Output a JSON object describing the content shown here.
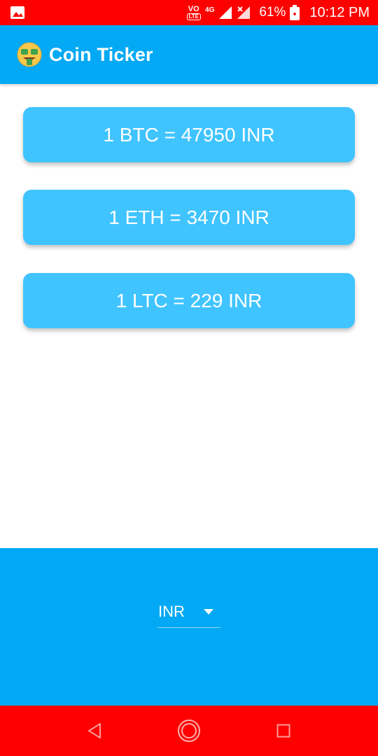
{
  "status_bar": {
    "network_vo": "VO",
    "network_lte": "LTE",
    "network_4g": "4G",
    "battery": "61%",
    "time": "10:12 PM"
  },
  "app_bar": {
    "title": "Coin Ticker",
    "color": "#03a9f4"
  },
  "rates": [
    {
      "label": "1 BTC = 47950 INR"
    },
    {
      "label": "1 ETH = 3470 INR"
    },
    {
      "label": "1 LTC = 229 INR"
    }
  ],
  "currency_picker": {
    "selected": "INR"
  },
  "colors": {
    "status_bar": "#ff0000",
    "card": "#40c4ff",
    "panel": "#03a9f4",
    "nav_bar": "#ff0000"
  },
  "nav": {
    "back": "back-icon",
    "home": "home-icon",
    "recents": "recents-icon"
  }
}
